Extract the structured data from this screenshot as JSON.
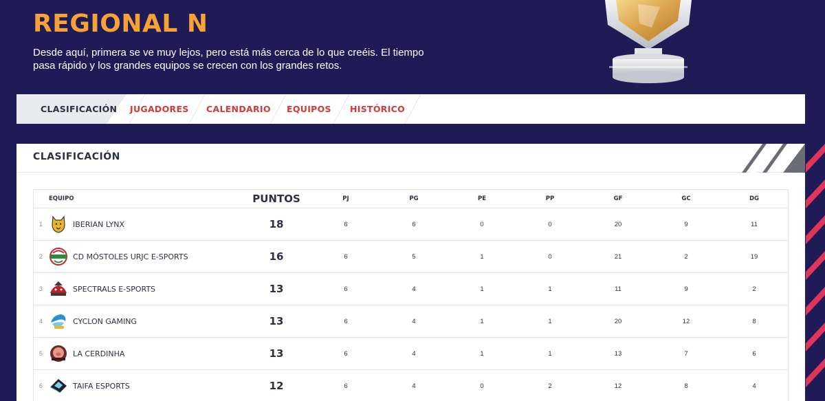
{
  "hero": {
    "title": "REGIONAL N",
    "description": "Desde aquí, primera se ve muy lejos, pero está más cerca de lo que creéis. El tiempo pasa rápido y los grandes equipos se crecen con los grandes retos."
  },
  "tabs": [
    {
      "label": "CLASIFICACIÓN",
      "active": true
    },
    {
      "label": "JUGADORES",
      "active": false
    },
    {
      "label": "CALENDARIO",
      "active": false
    },
    {
      "label": "EQUIPOS",
      "active": false
    },
    {
      "label": "HISTÓRICO",
      "active": false
    }
  ],
  "panel": {
    "title": "CLASIFICACIÓN"
  },
  "table": {
    "headers": {
      "team": "EQUIPO",
      "pts": "PUNTOS",
      "pj": "PJ",
      "pg": "PG",
      "pe": "PE",
      "pp": "PP",
      "gf": "GF",
      "gc": "GC",
      "dg": "DG"
    },
    "rows": [
      {
        "rank": "1",
        "team": "IBERIAN LYNX",
        "logo": "lynx-logo-icon",
        "pts": "18",
        "pj": "6",
        "pg": "6",
        "pe": "0",
        "pp": "0",
        "gf": "20",
        "gc": "9",
        "dg": "11"
      },
      {
        "rank": "2",
        "team": "CD MÓSTOLES URJC E-SPORTS",
        "logo": "mostoles-logo-icon",
        "pts": "16",
        "pj": "6",
        "pg": "5",
        "pe": "1",
        "pp": "0",
        "gf": "21",
        "gc": "2",
        "dg": "19"
      },
      {
        "rank": "3",
        "team": "SPECTRALS E-SPORTS",
        "logo": "spectrals-logo-icon",
        "pts": "13",
        "pj": "6",
        "pg": "4",
        "pe": "1",
        "pp": "1",
        "gf": "11",
        "gc": "9",
        "dg": "2"
      },
      {
        "rank": "4",
        "team": "CYCLON GAMING",
        "logo": "cyclon-logo-icon",
        "pts": "13",
        "pj": "6",
        "pg": "4",
        "pe": "1",
        "pp": "1",
        "gf": "20",
        "gc": "12",
        "dg": "8"
      },
      {
        "rank": "5",
        "team": "LA CERDINHA",
        "logo": "cerdinha-logo-icon",
        "pts": "13",
        "pj": "6",
        "pg": "4",
        "pe": "1",
        "pp": "1",
        "gf": "13",
        "gc": "7",
        "dg": "6"
      },
      {
        "rank": "6",
        "team": "TAIFA ESPORTS",
        "logo": "taifa-logo-icon",
        "pts": "12",
        "pj": "6",
        "pg": "4",
        "pe": "0",
        "pp": "2",
        "gf": "12",
        "gc": "8",
        "dg": "4"
      }
    ]
  },
  "colors": {
    "background": "#1e1b57",
    "accent_orange": "#f7a136",
    "tab_red": "#d1393c",
    "text_dark": "#2c3140",
    "stripe_red": "#e0355a"
  }
}
